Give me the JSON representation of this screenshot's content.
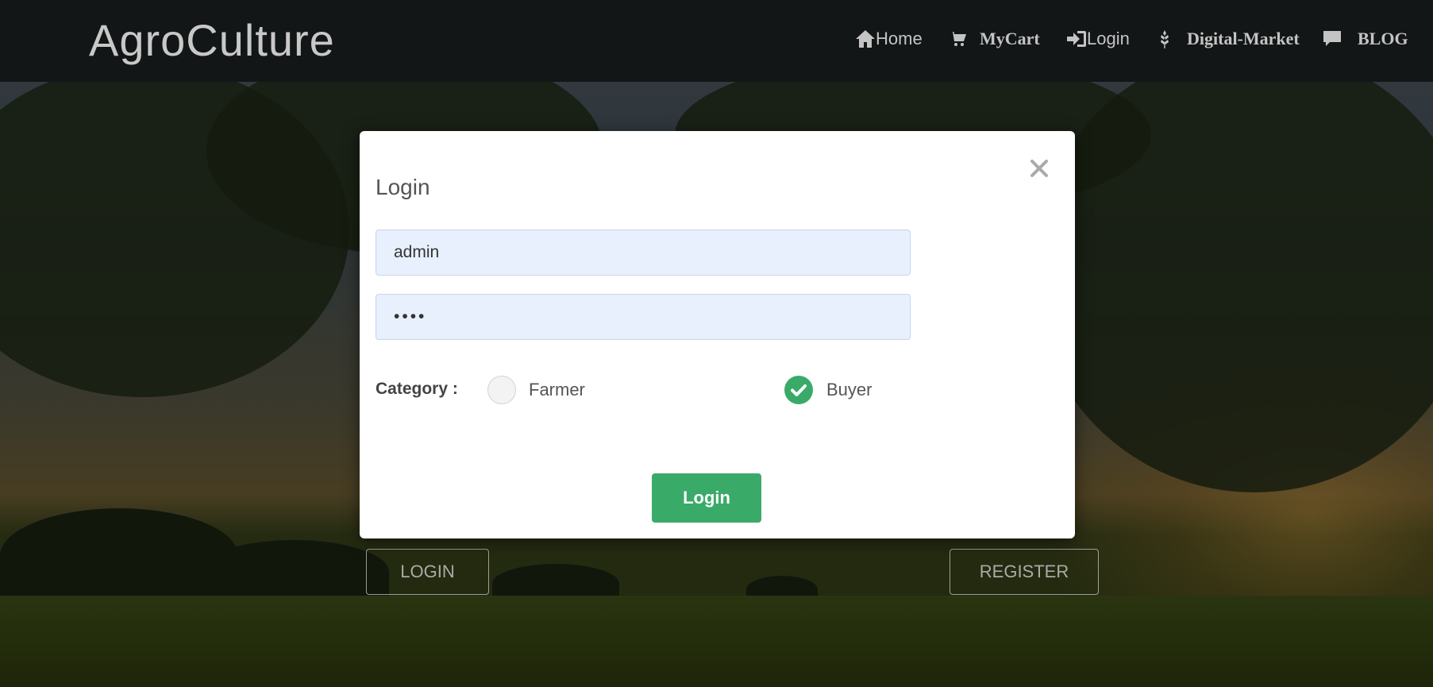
{
  "brand": "AgroCulture",
  "nav": [
    {
      "label": "Home",
      "icon": "home-icon"
    },
    {
      "label": "MyCart",
      "icon": "cart-icon"
    },
    {
      "label": "Login",
      "icon": "sign-in-icon"
    },
    {
      "label": "Digital-Market",
      "icon": "grain-icon"
    },
    {
      "label": "BLOG",
      "icon": "comment-icon"
    }
  ],
  "hero": {
    "login_label": "LOGIN",
    "register_label": "REGISTER"
  },
  "modal": {
    "title": "Login",
    "username_value": "admin",
    "password_value": "••••",
    "category_label": "Category :",
    "options": [
      {
        "label": "Farmer",
        "selected": false
      },
      {
        "label": "Buyer",
        "selected": true
      }
    ],
    "submit_label": "Login",
    "close_icon": "close-icon"
  },
  "colors": {
    "accent": "#3aaa68",
    "navbar": "#131616",
    "input_bg": "#e8f0fe"
  }
}
